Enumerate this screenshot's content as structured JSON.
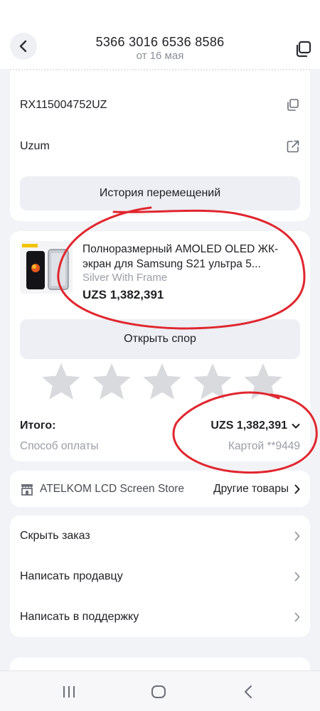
{
  "header": {
    "order_number": "5366 3016 6536 8586",
    "date": "от 16 мая"
  },
  "tracking": {
    "number": "RX115004752UZ",
    "carrier": "Uzum",
    "history_button": "История перемещений"
  },
  "product": {
    "title": "Полноразмерный AMOLED OLED ЖК-экран для Samsung S21 ультра 5...",
    "variant": "Silver With Frame",
    "price": "UZS 1,382,391",
    "dispute_button": "Открыть спор",
    "rating_max": 5,
    "rating_value": 0
  },
  "summary": {
    "total_label": "Итого:",
    "total_value": "UZS 1,382,391",
    "payment_label": "Способ оплаты",
    "payment_value": "Картой **9449"
  },
  "store": {
    "name": "ATELKOM LCD Screen Store",
    "more_link": "Другие товары"
  },
  "menu": {
    "items": [
      "Скрыть заказ",
      "Написать продавцу",
      "Написать в поддержку"
    ]
  },
  "colors": {
    "accent_red": "#e0262e",
    "icon_gray": "#6b6e78",
    "star_gray": "#d9dadd"
  }
}
